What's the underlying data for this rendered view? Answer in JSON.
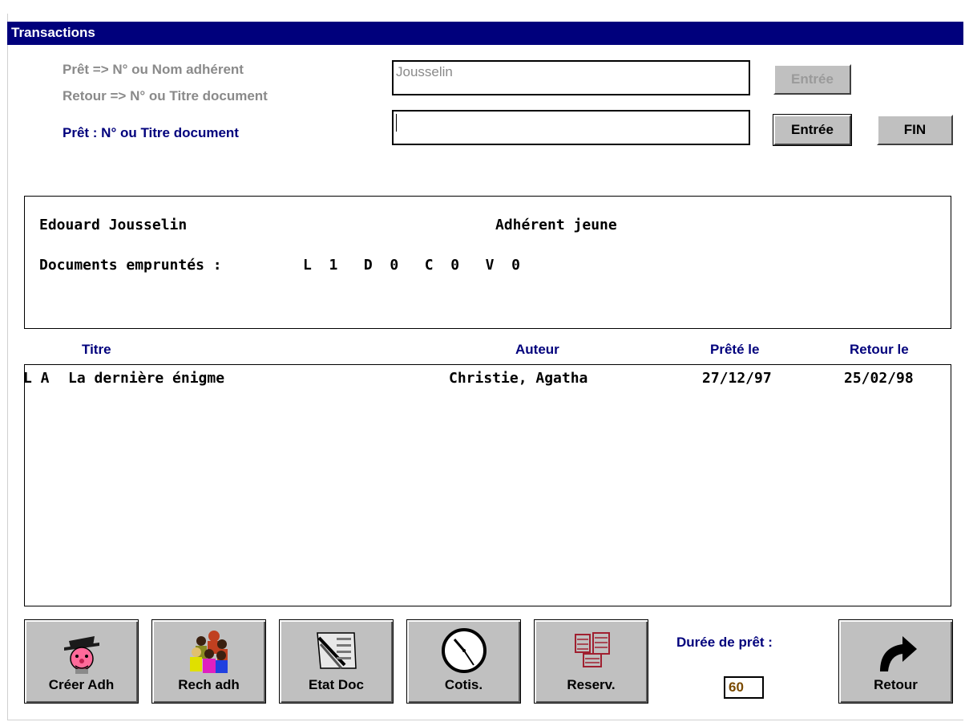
{
  "window": {
    "title": "Transactions"
  },
  "form": {
    "hint_line1": "Prêt => N° ou Nom adhérent",
    "hint_line2": "Retour => N° ou Titre document",
    "loan_label": "Prêt : N° ou Titre document",
    "member_value": "Jousselin",
    "document_value": "",
    "enter1_label": "Entrée",
    "enter2_label": "Entrée",
    "fin_label": "FIN"
  },
  "member": {
    "name": "Edouard Jousselin",
    "category": "Adhérent jeune",
    "borrowed_label": "Documents empruntés :",
    "counts": "L  1   D  0   C  0   V  0"
  },
  "loans": {
    "headers": {
      "title": "Titre",
      "author": "Auteur",
      "loaned": "Prêté le",
      "return": "Retour le"
    },
    "rows": [
      {
        "type": "L A",
        "title": "La dernière énigme",
        "author": "Christie, Agatha",
        "loaned": "27/12/97",
        "return": "25/02/98"
      }
    ]
  },
  "toolbar": {
    "create_member": "Créer Adh",
    "search_member": "Rech adh",
    "doc_status": "Etat Doc",
    "subscription": "Cotis.",
    "reservation": "Reserv.",
    "return": "Retour"
  },
  "loan_duration": {
    "label": "Durée de prêt :",
    "value": "60"
  },
  "colors": {
    "titlebar": "#00007c",
    "label_navy": "#00007c",
    "button_face": "#c0c0c0",
    "duration_text": "#7a4a00"
  }
}
